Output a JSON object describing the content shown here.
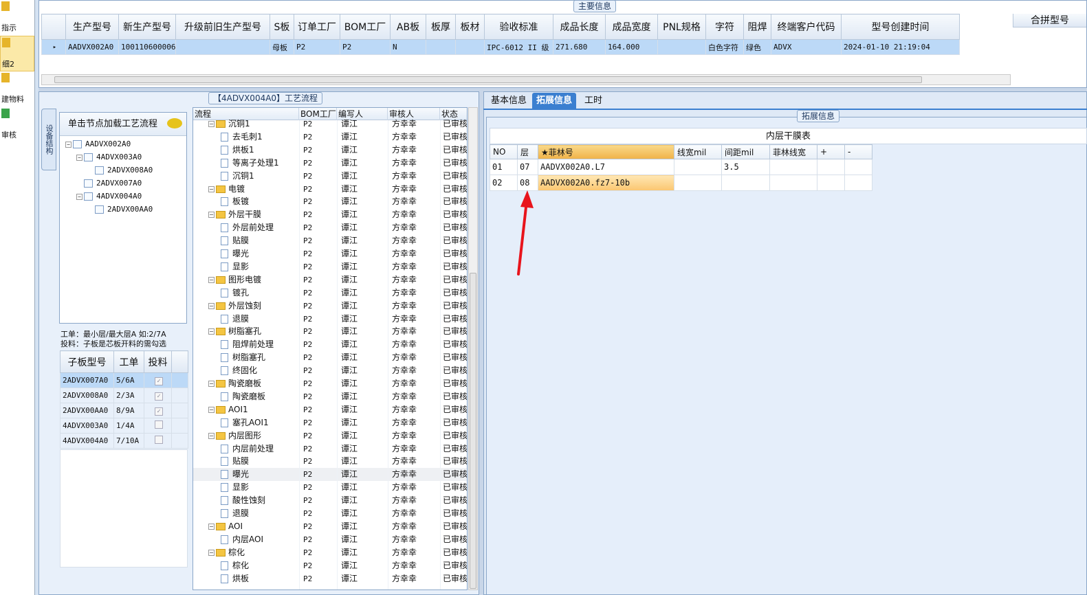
{
  "left_nav": {
    "items": [
      {
        "label": "指示",
        "active": false
      },
      {
        "label": "细2",
        "active": true
      },
      {
        "label": "建物料",
        "active": false
      },
      {
        "label": "审核",
        "active": false
      }
    ]
  },
  "main_info": {
    "group_title": "主要信息",
    "columns": [
      "生产型号",
      "新生产型号",
      "升级前旧生产型号",
      "S板",
      "订单工厂",
      "BOM工厂",
      "AB板",
      "板厚",
      "板材",
      "验收标准",
      "成品长度",
      "成品宽度",
      "PNL规格",
      "字符",
      "阻焊",
      "终端客户代码",
      "型号创建时间"
    ],
    "extra_header": "合拼型号",
    "rows": [
      [
        "AADVX002A0",
        "10011060000608",
        "",
        "母板",
        "P2",
        "P2",
        "N",
        "",
        "",
        "IPC-6012 II 级",
        "271.680",
        "164.000",
        "",
        "白色字符",
        "绿色",
        "ADVX",
        "2024-01-10 21:19:04"
      ]
    ]
  },
  "flow_panel": {
    "group_title": "【4ADVX004A0】工艺流程",
    "vertical_tab": "设备结构",
    "tree_header": "单击节点加载工艺流程",
    "tree": [
      {
        "label": "AADVX002A0",
        "level": 0,
        "expander": "−"
      },
      {
        "label": "4ADVX003A0",
        "level": 1,
        "expander": "−"
      },
      {
        "label": "2ADVX008A0",
        "level": 2,
        "expander": ""
      },
      {
        "label": "2ADVX007A0",
        "level": 1,
        "expander": ""
      },
      {
        "label": "4ADVX004A0",
        "level": 1,
        "expander": "−"
      },
      {
        "label": "2ADVX00AA0",
        "level": 2,
        "expander": ""
      }
    ],
    "note_line1": "工单：最小层/最大层A 如:2/7A",
    "note_line2": "投料：子板是芯板开料的需勾选",
    "sub_columns": [
      "子板型号",
      "工单",
      "投料"
    ],
    "sub_rows": [
      {
        "model": "2ADVX007A0",
        "order": "5/6A",
        "feed": true
      },
      {
        "model": "2ADVX008A0",
        "order": "2/3A",
        "feed": true
      },
      {
        "model": "2ADVX00AA0",
        "order": "8/9A",
        "feed": true
      },
      {
        "model": "4ADVX003A0",
        "order": "1/4A",
        "feed": false
      },
      {
        "model": "4ADVX004A0",
        "order": "7/10A",
        "feed": false
      }
    ],
    "flow_columns": [
      "流程",
      "BOM工厂",
      "编写人",
      "审核人",
      "状态"
    ],
    "flow_rows": [
      {
        "name": "沉铜1",
        "folder": true,
        "factory": "P2",
        "writer": "谭江",
        "reviewer": "方幸幸",
        "status": "已审核"
      },
      {
        "name": "去毛刺1",
        "folder": false,
        "factory": "P2",
        "writer": "谭江",
        "reviewer": "方幸幸",
        "status": "已审核"
      },
      {
        "name": "烘板1",
        "folder": false,
        "factory": "P2",
        "writer": "谭江",
        "reviewer": "方幸幸",
        "status": "已审核"
      },
      {
        "name": "等离子处理1",
        "folder": false,
        "factory": "P2",
        "writer": "谭江",
        "reviewer": "方幸幸",
        "status": "已审核"
      },
      {
        "name": "沉铜1",
        "folder": false,
        "factory": "P2",
        "writer": "谭江",
        "reviewer": "方幸幸",
        "status": "已审核"
      },
      {
        "name": "电镀",
        "folder": true,
        "factory": "P2",
        "writer": "谭江",
        "reviewer": "方幸幸",
        "status": "已审核"
      },
      {
        "name": "板镀",
        "folder": false,
        "factory": "P2",
        "writer": "谭江",
        "reviewer": "方幸幸",
        "status": "已审核"
      },
      {
        "name": "外层干膜",
        "folder": true,
        "factory": "P2",
        "writer": "谭江",
        "reviewer": "方幸幸",
        "status": "已审核"
      },
      {
        "name": "外层前处理",
        "folder": false,
        "factory": "P2",
        "writer": "谭江",
        "reviewer": "方幸幸",
        "status": "已审核"
      },
      {
        "name": "贴膜",
        "folder": false,
        "factory": "P2",
        "writer": "谭江",
        "reviewer": "方幸幸",
        "status": "已审核"
      },
      {
        "name": "曝光",
        "folder": false,
        "factory": "P2",
        "writer": "谭江",
        "reviewer": "方幸幸",
        "status": "已审核"
      },
      {
        "name": "显影",
        "folder": false,
        "factory": "P2",
        "writer": "谭江",
        "reviewer": "方幸幸",
        "status": "已审核"
      },
      {
        "name": "图形电镀",
        "folder": true,
        "factory": "P2",
        "writer": "谭江",
        "reviewer": "方幸幸",
        "status": "已审核"
      },
      {
        "name": "镀孔",
        "folder": false,
        "factory": "P2",
        "writer": "谭江",
        "reviewer": "方幸幸",
        "status": "已审核"
      },
      {
        "name": "外层蚀刻",
        "folder": true,
        "factory": "P2",
        "writer": "谭江",
        "reviewer": "方幸幸",
        "status": "已审核"
      },
      {
        "name": "退膜",
        "folder": false,
        "factory": "P2",
        "writer": "谭江",
        "reviewer": "方幸幸",
        "status": "已审核"
      },
      {
        "name": "树脂塞孔",
        "folder": true,
        "factory": "P2",
        "writer": "谭江",
        "reviewer": "方幸幸",
        "status": "已审核"
      },
      {
        "name": "阻焊前处理",
        "folder": false,
        "factory": "P2",
        "writer": "谭江",
        "reviewer": "方幸幸",
        "status": "已审核"
      },
      {
        "name": "树脂塞孔",
        "folder": false,
        "factory": "P2",
        "writer": "谭江",
        "reviewer": "方幸幸",
        "status": "已审核"
      },
      {
        "name": "终固化",
        "folder": false,
        "factory": "P2",
        "writer": "谭江",
        "reviewer": "方幸幸",
        "status": "已审核"
      },
      {
        "name": "陶瓷磨板",
        "folder": true,
        "factory": "P2",
        "writer": "谭江",
        "reviewer": "方幸幸",
        "status": "已审核"
      },
      {
        "name": "陶瓷磨板",
        "folder": false,
        "factory": "P2",
        "writer": "谭江",
        "reviewer": "方幸幸",
        "status": "已审核"
      },
      {
        "name": "AOI1",
        "folder": true,
        "factory": "P2",
        "writer": "谭江",
        "reviewer": "方幸幸",
        "status": "已审核"
      },
      {
        "name": "塞孔AOI1",
        "folder": false,
        "factory": "P2",
        "writer": "谭江",
        "reviewer": "方幸幸",
        "status": "已审核"
      },
      {
        "name": "内层图形",
        "folder": true,
        "factory": "P2",
        "writer": "谭江",
        "reviewer": "方幸幸",
        "status": "已审核"
      },
      {
        "name": "内层前处理",
        "folder": false,
        "factory": "P2",
        "writer": "谭江",
        "reviewer": "方幸幸",
        "status": "已审核"
      },
      {
        "name": "贴膜",
        "folder": false,
        "factory": "P2",
        "writer": "谭江",
        "reviewer": "方幸幸",
        "status": "已审核"
      },
      {
        "name": "曝光",
        "folder": false,
        "factory": "P2",
        "writer": "谭江",
        "reviewer": "方幸幸",
        "status": "已审核",
        "highlight": true
      },
      {
        "name": "显影",
        "folder": false,
        "factory": "P2",
        "writer": "谭江",
        "reviewer": "方幸幸",
        "status": "已审核"
      },
      {
        "name": "酸性蚀刻",
        "folder": false,
        "factory": "P2",
        "writer": "谭江",
        "reviewer": "方幸幸",
        "status": "已审核"
      },
      {
        "name": "退膜",
        "folder": false,
        "factory": "P2",
        "writer": "谭江",
        "reviewer": "方幸幸",
        "status": "已审核"
      },
      {
        "name": "AOI",
        "folder": true,
        "factory": "P2",
        "writer": "谭江",
        "reviewer": "方幸幸",
        "status": "已审核"
      },
      {
        "name": "内层AOI",
        "folder": false,
        "factory": "P2",
        "writer": "谭江",
        "reviewer": "方幸幸",
        "status": "已审核"
      },
      {
        "name": "棕化",
        "folder": true,
        "factory": "P2",
        "writer": "谭江",
        "reviewer": "方幸幸",
        "status": "已审核"
      },
      {
        "name": "棕化",
        "folder": false,
        "factory": "P2",
        "writer": "谭江",
        "reviewer": "方幸幸",
        "status": "已审核"
      },
      {
        "name": "烘板",
        "folder": false,
        "factory": "P2",
        "writer": "谭江",
        "reviewer": "方幸幸",
        "status": "已审核"
      }
    ]
  },
  "right_panel": {
    "tabs": [
      {
        "label": "基本信息",
        "active": false
      },
      {
        "label": "拓展信息",
        "active": true
      },
      {
        "label": "工时",
        "active": false
      }
    ],
    "group_title": "拓展信息",
    "table_title": "内层干膜表",
    "columns": [
      "NO",
      "层",
      "★菲林号",
      "线宽mil",
      "间距mil",
      "菲林线宽",
      "+",
      "-"
    ],
    "rows": [
      [
        "01",
        "07",
        "AADVX002A0.L7",
        "",
        "3.5",
        "",
        "",
        ""
      ],
      [
        "02",
        "08",
        "AADVX002A0.fz7-10b",
        "",
        "",
        "",
        "",
        ""
      ]
    ]
  },
  "colors": {
    "accent": "#3b7fd0",
    "selection": "#bcd9f7",
    "annotation_arrow": "#e8141c",
    "highlight_cell": "#fbc670"
  }
}
